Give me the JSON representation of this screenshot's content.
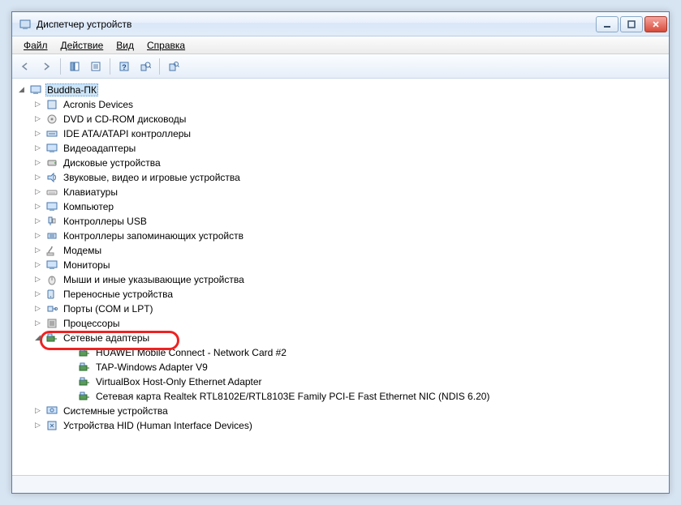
{
  "window": {
    "title": "Диспетчер устройств"
  },
  "menu": {
    "file": "Файл",
    "action": "Действие",
    "view": "Вид",
    "help": "Справка"
  },
  "root": {
    "name": "Buddha-ПК"
  },
  "categories": [
    {
      "label": "Acronis Devices"
    },
    {
      "label": "DVD и CD-ROM дисководы"
    },
    {
      "label": "IDE ATA/ATAPI контроллеры"
    },
    {
      "label": "Видеоадаптеры"
    },
    {
      "label": "Дисковые устройства"
    },
    {
      "label": "Звуковые, видео и игровые устройства"
    },
    {
      "label": "Клавиатуры"
    },
    {
      "label": "Компьютер"
    },
    {
      "label": "Контроллеры USB"
    },
    {
      "label": "Контроллеры запоминающих устройств"
    },
    {
      "label": "Модемы"
    },
    {
      "label": "Мониторы"
    },
    {
      "label": "Мыши и иные указывающие устройства"
    },
    {
      "label": "Переносные устройства"
    },
    {
      "label": "Порты (COM и LPT)"
    },
    {
      "label": "Процессоры"
    },
    {
      "label": "Сетевые адаптеры",
      "expanded": true,
      "highlighted": true
    },
    {
      "label": "Системные устройства"
    },
    {
      "label": "Устройства HID (Human Interface Devices)"
    }
  ],
  "network_adapters": [
    {
      "label": "HUAWEI Mobile Connect - Network Card #2"
    },
    {
      "label": "TAP-Windows Adapter V9"
    },
    {
      "label": "VirtualBox Host-Only Ethernet Adapter"
    },
    {
      "label": "Сетевая карта Realtek RTL8102E/RTL8103E Family PCI-E Fast Ethernet NIC (NDIS 6.20)"
    }
  ]
}
